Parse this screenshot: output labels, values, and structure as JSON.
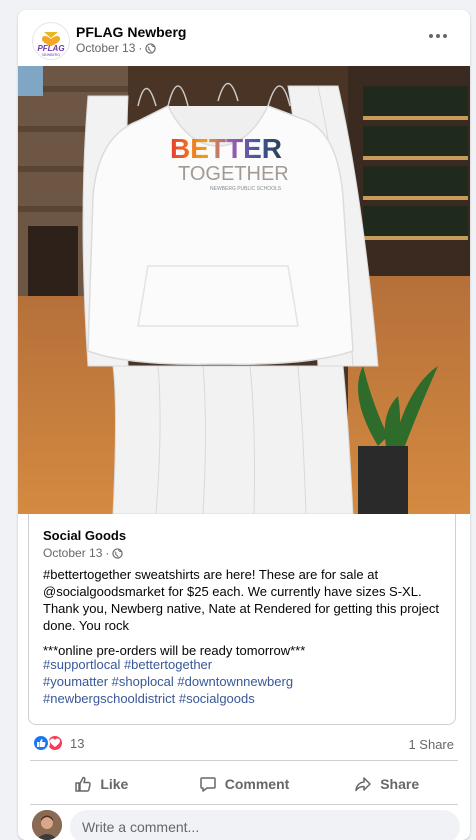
{
  "post": {
    "page_name": "PFLAG Newberg",
    "date": "October 13",
    "logo_text": "PFLAG",
    "logo_subtext": "NEWBERG"
  },
  "photo": {
    "shirt_line1": "BETTER",
    "shirt_line2": "TOGETHER",
    "shirt_line3": "NEWBERG PUBLIC SCHOOLS"
  },
  "shared_post": {
    "author": "Social Goods",
    "date": "October 13",
    "body": "#bettertogether sweatshirts are here! These are for sale at @socialgoodsmarket  for $25 each. We currently have sizes S-XL. Thank you, Newberg native, Nate at Rendered for getting this project done. You rock",
    "note": "***online pre-orders will be ready tomorrow***",
    "tags_line1": "#supportlocal #bettertogether",
    "tags_line2": "#youmatter #shoplocal #downtownnewberg",
    "tags_line3": "#newbergschooldistrict #socialgoods"
  },
  "stats": {
    "reaction_count": "13",
    "share_count": "1 Share"
  },
  "actions": {
    "like": "Like",
    "comment": "Comment",
    "share": "Share"
  },
  "comment_box": {
    "placeholder": "Write a comment..."
  },
  "colors": {
    "link": "#385898",
    "like_blue": "#1877f2",
    "love_red": "#f33e58",
    "meta_gray": "#65676b"
  }
}
